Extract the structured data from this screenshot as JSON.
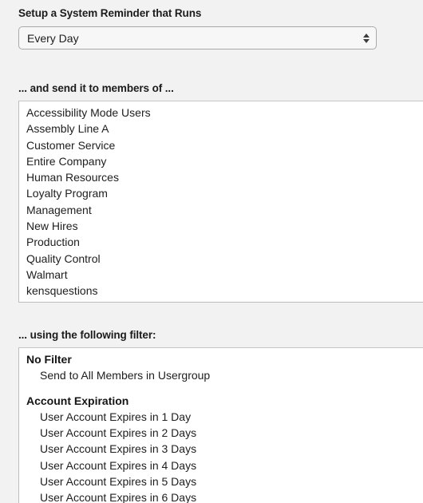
{
  "schedule": {
    "heading": "Setup a System Reminder that Runs",
    "selected": "Every Day",
    "arrow_up_icon": "triangle-up-icon",
    "arrow_down_icon": "triangle-down-icon"
  },
  "members": {
    "heading": "... and send it to members of ...",
    "items": [
      "Accessibility Mode Users",
      "Assembly Line A",
      "Customer Service",
      "Entire Company",
      "Human Resources",
      "Loyalty Program",
      "Management",
      "New Hires",
      "Production",
      "Quality Control",
      "Walmart",
      "kensquestions"
    ]
  },
  "filter": {
    "heading": "... using the following filter:",
    "groups": [
      {
        "label": "No Filter",
        "options": [
          "Send to All Members in Usergroup"
        ]
      },
      {
        "label": "Account Expiration",
        "options": [
          "User Account Expires in 1 Day",
          "User Account Expires in 2 Days",
          "User Account Expires in 3 Days",
          "User Account Expires in 4 Days",
          "User Account Expires in 5 Days",
          "User Account Expires in 6 Days"
        ]
      }
    ]
  },
  "colors": {
    "page_background": "#f2f2f2",
    "listbox_background": "#ffffff",
    "listbox_border": "#bdbdbd",
    "select_background": "#f7f7f7",
    "select_border": "#a9a9a9",
    "text": "#202020"
  }
}
